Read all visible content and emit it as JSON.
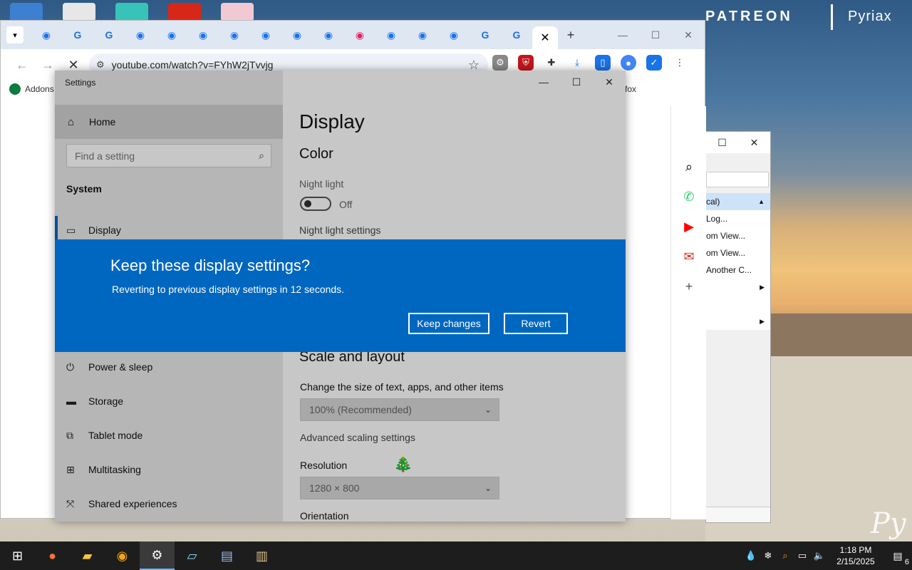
{
  "wallpaper": {
    "brand": "PATREON",
    "artist": "Pyriax",
    "signature": "Py"
  },
  "browser": {
    "url": "youtube.com/watch?v=FYhW2jTvvjg",
    "tab_favicons": [
      "◉",
      "G",
      "G",
      "◉",
      "◉",
      "◉",
      "◉",
      "◉",
      "◉",
      "◉",
      "◉",
      "◉",
      "◉",
      "◉",
      "G",
      "G"
    ],
    "active_tab_close": "✕",
    "new_tab": "+",
    "bookmark_left": "Addons",
    "bookmark_right": "fox",
    "controls": {
      "minimize": "—",
      "maximize": "☐",
      "close": "✕"
    }
  },
  "side_panel": {
    "icons": [
      "search-icon",
      "whatsapp-icon",
      "youtube-icon",
      "gmail-icon",
      "add-icon"
    ]
  },
  "bg_window": {
    "menu": [
      {
        "label": "cal)",
        "selected": true
      },
      {
        "label": "Log...",
        "selected": false
      },
      {
        "label": "om View...",
        "selected": false
      },
      {
        "label": "om View...",
        "selected": false
      },
      {
        "label": "Another C...",
        "selected": false
      },
      {
        "label": "",
        "selected": false
      },
      {
        "label": "",
        "selected": false
      },
      {
        "label": "",
        "selected": false
      }
    ]
  },
  "settings": {
    "window_title": "Settings",
    "home": "Home",
    "search_placeholder": "Find a setting",
    "section": "System",
    "nav": {
      "display": "Display",
      "power": "Power & sleep",
      "storage": "Storage",
      "tablet": "Tablet mode",
      "multitasking": "Multitasking",
      "shared": "Shared experiences"
    },
    "page_title": "Display",
    "color_heading": "Color",
    "night_light_label": "Night light",
    "night_light_state": "Off",
    "night_light_link": "Night light settings",
    "scale_heading": "Scale and layout",
    "scale_label": "Change the size of text, apps, and other items",
    "scale_value": "100% (Recommended)",
    "advanced_scaling": "Advanced scaling settings",
    "resolution_label": "Resolution",
    "resolution_value": "1280 × 800",
    "orientation_label": "Orientation"
  },
  "dialog": {
    "title": "Keep these display settings?",
    "message": "Reverting to previous display settings in 12 seconds.",
    "keep_button": "Keep changes",
    "revert_button": "Revert",
    "accent": "#0067c0"
  },
  "taskbar": {
    "apps": [
      "windows-start-icon",
      "firefox-icon",
      "file-explorer-icon",
      "chrome-canary-icon",
      "settings-icon",
      "notepad-icon",
      "app-icon",
      "app-icon-2"
    ],
    "time": "1:18 PM",
    "date": "2/15/2025",
    "notification_count": "6"
  }
}
